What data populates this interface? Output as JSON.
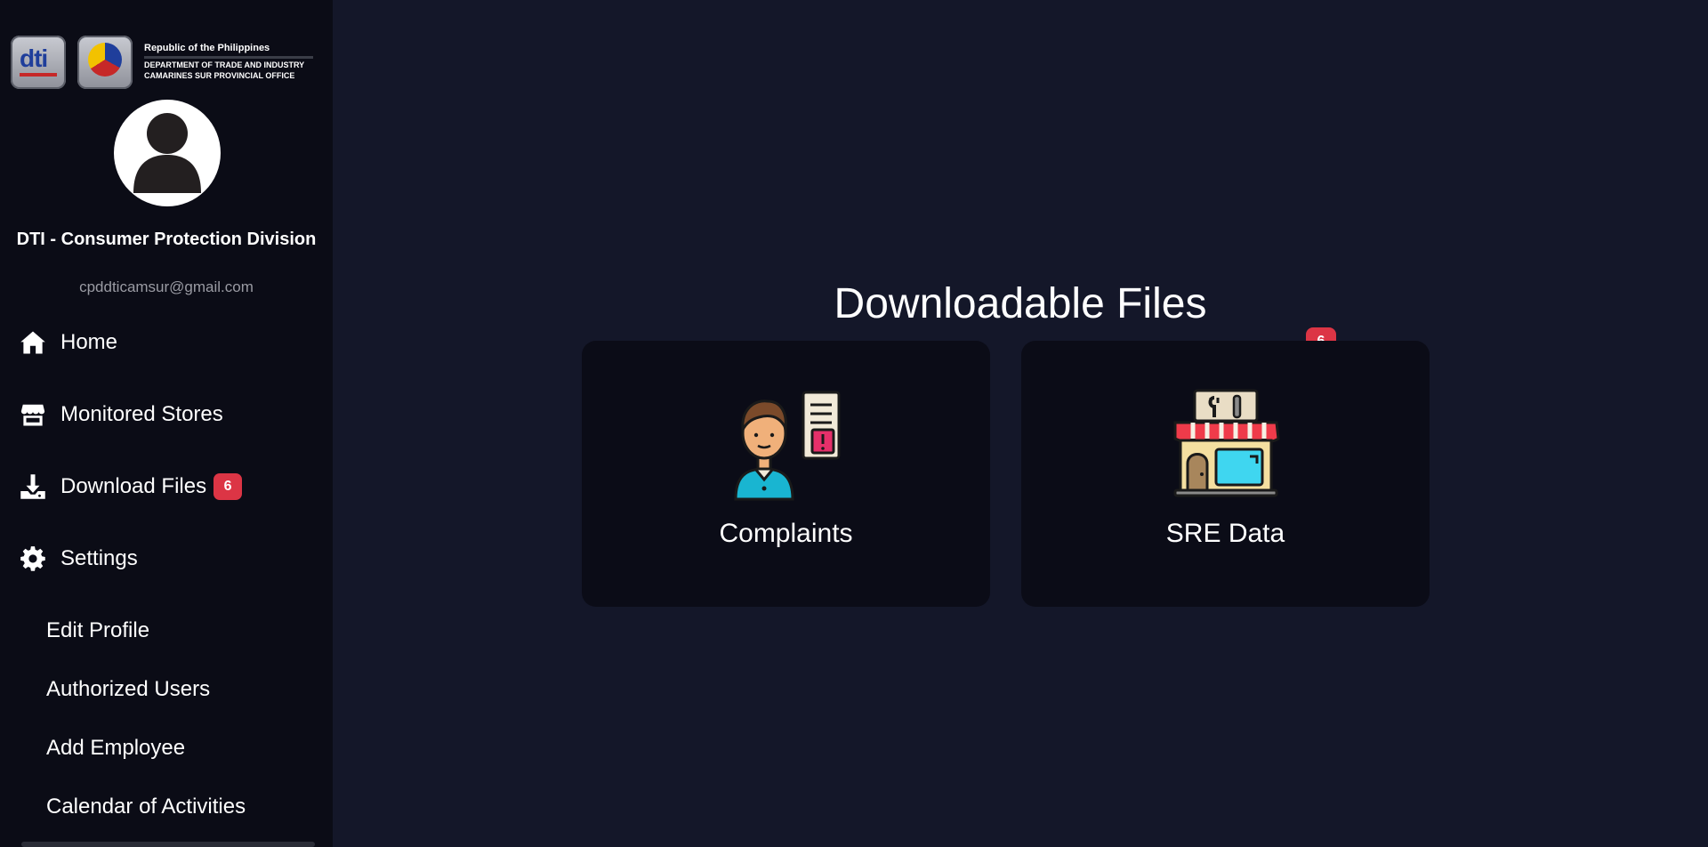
{
  "brand": {
    "dti_logo": "dti",
    "country": "Republic of the Philippines",
    "department": "DEPARTMENT OF TRADE AND INDUSTRY",
    "office": "CAMARINES SUR PROVINCIAL OFFICE"
  },
  "profile": {
    "name": "DTI - Consumer Protection Division",
    "email": "cpddticamsur@gmail.com"
  },
  "nav": {
    "home": "Home",
    "monitored_stores": "Monitored Stores",
    "download_files": "Download Files",
    "download_badge": "6",
    "settings": "Settings",
    "edit_profile": "Edit Profile",
    "authorized_users": "Authorized Users",
    "add_employee": "Add Employee",
    "calendar": "Calendar of Activities"
  },
  "main": {
    "title": "Downloadable Files",
    "complaints_label": "Complaints",
    "complaints_badge": "6",
    "sre_label": "SRE Data"
  },
  "colors": {
    "background": "#141729",
    "sidebar": "#0b0c16",
    "card": "#0b0c17",
    "badge": "#dc3545"
  }
}
